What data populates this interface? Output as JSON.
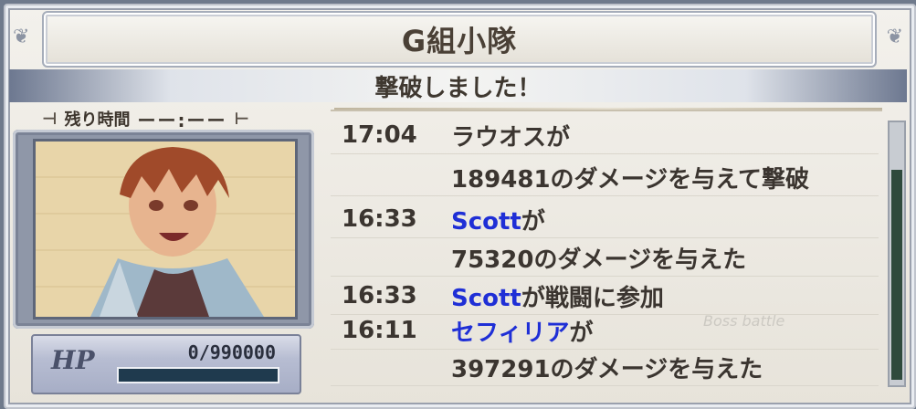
{
  "header": {
    "title": "G組小隊"
  },
  "status": {
    "message": "撃破しました！"
  },
  "timer": {
    "label": "残り時間",
    "value": "ーー:ーー"
  },
  "hp": {
    "label": "HP",
    "value": "0/990000",
    "fraction": 0
  },
  "log": [
    {
      "time": "17:04",
      "line1": "ラウオスが",
      "line2": "189481のダメージを与えて撃破",
      "name": ""
    },
    {
      "time": "16:33",
      "name": "Scott",
      "line1": "が",
      "line2": "75320のダメージを与えた"
    },
    {
      "time": "16:33",
      "name": "Scott",
      "line1": "が戦闘に参加",
      "line2": ""
    },
    {
      "time": "16:11",
      "name": "セフィリア",
      "line1": "が",
      "line2": "397291のダメージを与えた"
    }
  ],
  "decor": {
    "stamp_text": "Boss battle"
  },
  "colors": {
    "player_name": "#1f2fd6",
    "hp_track": "#1f3a4e"
  }
}
